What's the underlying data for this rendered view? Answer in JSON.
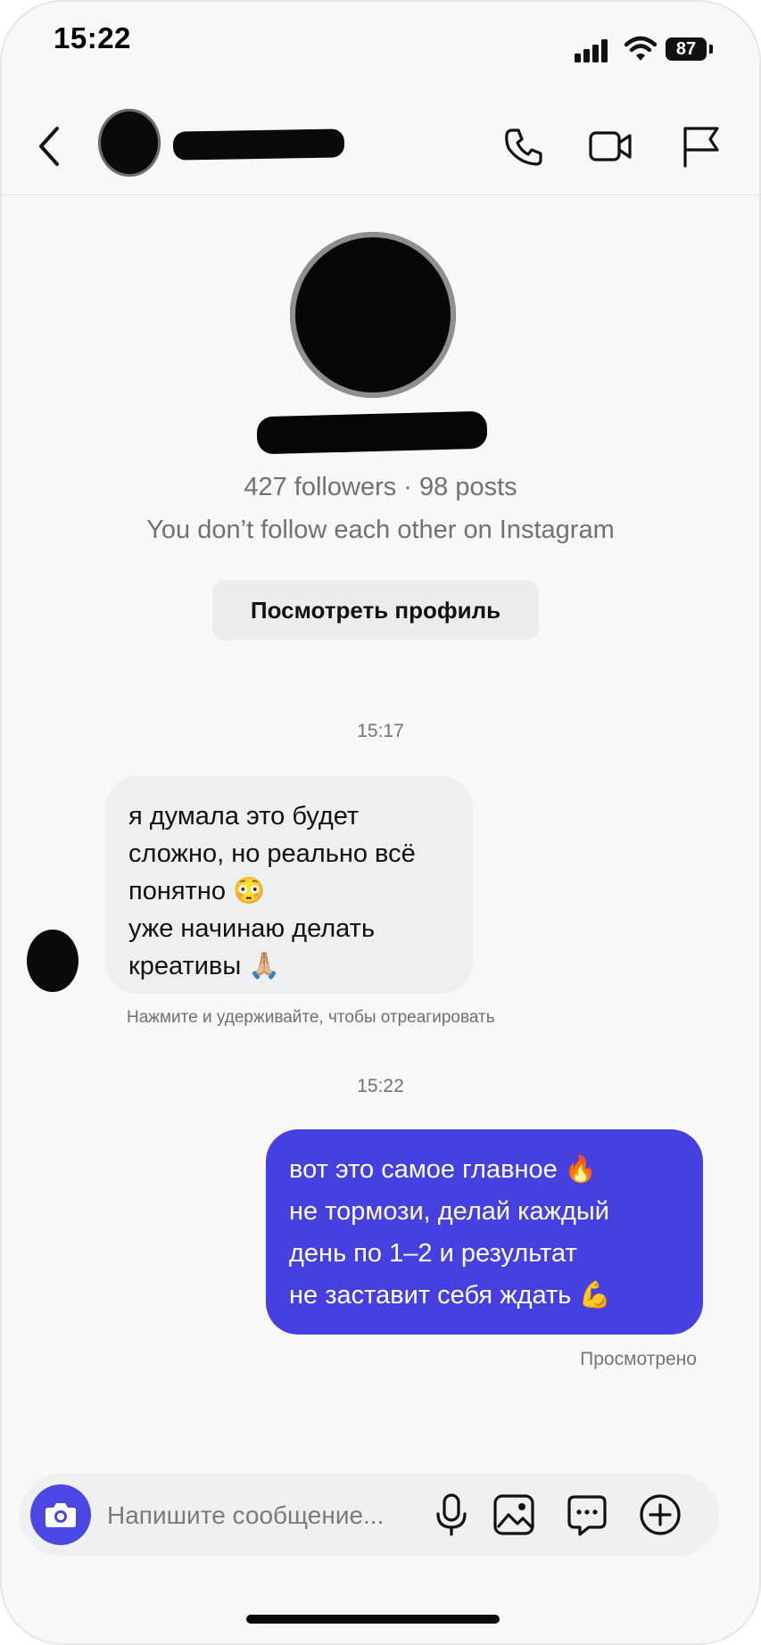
{
  "status_bar": {
    "time": "15:22",
    "battery": "87"
  },
  "header": {
    "icons": [
      "back-icon",
      "phone-icon",
      "video-camera-icon",
      "flag-icon"
    ]
  },
  "profile": {
    "stats": "427 followers · 98 posts",
    "relation": "You don’t follow each other on Instagram",
    "view_profile_button": "Посмотреть профиль"
  },
  "conversation": {
    "timestamp_1": "15:17",
    "incoming_message": {
      "lines": [
        "я думала это будет",
        "сложно, но реально всё",
        "понятно 😳",
        "уже начинаю делать",
        "креативы 🙏🏼"
      ]
    },
    "reaction_hint": "Нажмите и удерживайте, чтобы отреагировать",
    "timestamp_2": "15:22",
    "outgoing_message": {
      "lines": [
        "вот это самое главное 🔥",
        "не тормози, делай каждый",
        "день по 1–2 и результат",
        "не заставит себя ждать 💪"
      ]
    },
    "seen_status": "Просмотрено"
  },
  "composer": {
    "placeholder": "Напишите сообщение..."
  },
  "colors": {
    "outgoing_bubble": "#4740e0",
    "camera_button": "#4b46e4",
    "incoming_bubble": "#eeeff1"
  }
}
